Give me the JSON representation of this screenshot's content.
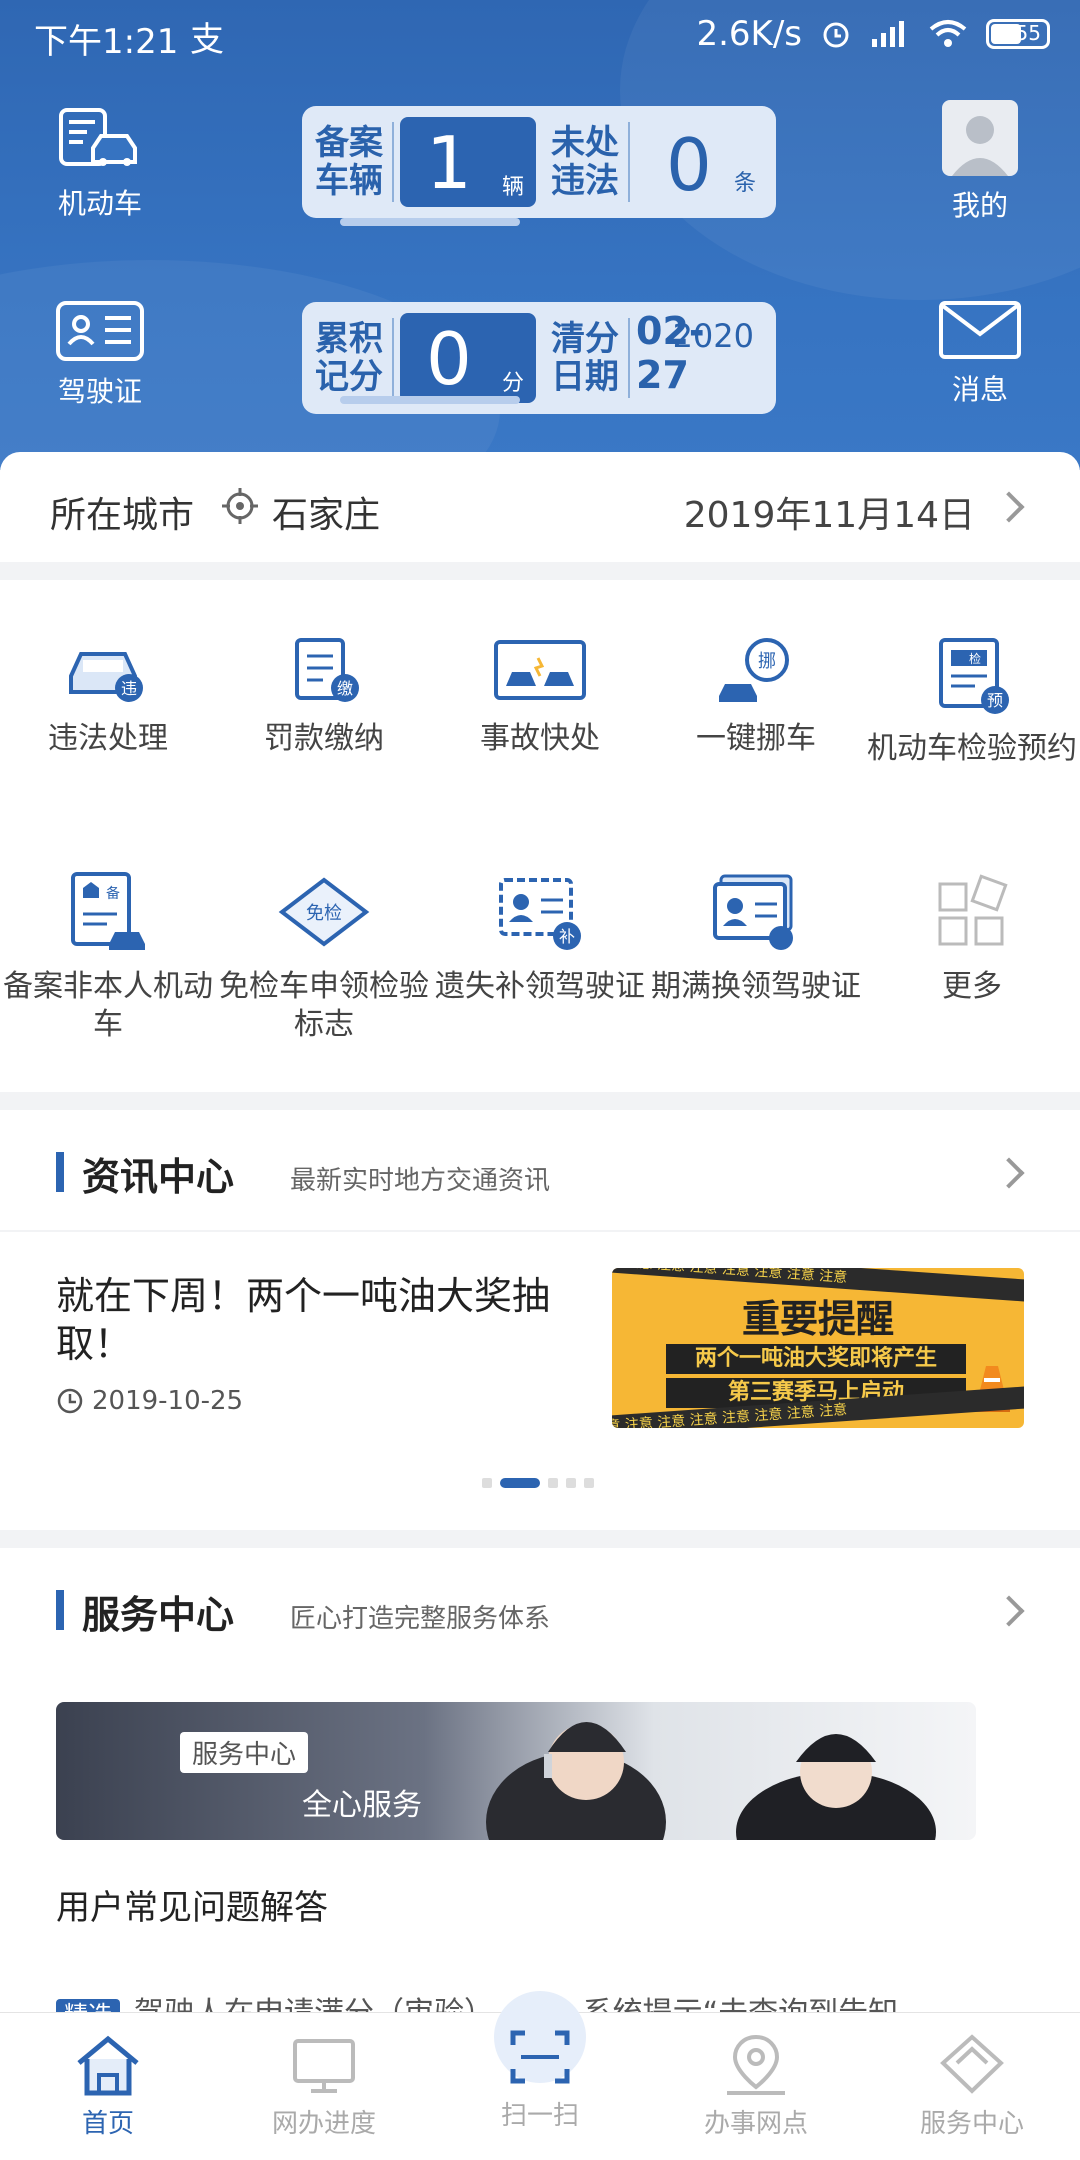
{
  "status_bar": {
    "time": "下午1:21",
    "pay_icon": "支",
    "net_speed": "2.6K/s",
    "battery": "55"
  },
  "header": {
    "left_top": {
      "label": "机动车",
      "icon": "car-document-icon"
    },
    "left_bottom": {
      "label": "驾驶证",
      "icon": "license-icon"
    },
    "right_top": {
      "label": "我的",
      "icon": "avatar-icon"
    },
    "right_bottom": {
      "label": "消息",
      "icon": "envelope-icon"
    },
    "vehicles": {
      "label_line1": "备案",
      "label_line2": "车辆",
      "value": "1",
      "unit": "辆"
    },
    "violations": {
      "label_line1": "未处",
      "label_line2": "违法",
      "value": "0",
      "unit": "条"
    },
    "points": {
      "label_line1": "累积",
      "label_line2": "记分",
      "value": "0",
      "unit": "分"
    },
    "clear_date": {
      "label_line1": "清分",
      "label_line2": "日期",
      "year": "2020",
      "month_day": "02-27"
    }
  },
  "city_bar": {
    "label": "所在城市",
    "city": "石家庄",
    "date": "2019年11月14日"
  },
  "services": [
    {
      "label": "违法处理",
      "icon": "violation-car-icon"
    },
    {
      "label": "罚款缴纳",
      "icon": "fine-payment-icon"
    },
    {
      "label": "事故快处",
      "icon": "accident-icon"
    },
    {
      "label": "一键挪车",
      "icon": "move-car-icon"
    },
    {
      "label": "机动车检验预约",
      "icon": "inspection-appointment-icon"
    },
    {
      "label": "备案非本人机动车",
      "icon": "register-vehicle-icon"
    },
    {
      "label": "免检车申领检验标志",
      "icon": "exempt-label-icon"
    },
    {
      "label": "遗失补领驾驶证",
      "icon": "reissue-license-icon"
    },
    {
      "label": "期满换领驾驶证",
      "icon": "renew-license-icon"
    },
    {
      "label": "更多",
      "icon": "more-grid-icon"
    }
  ],
  "news": {
    "title": "资讯中心",
    "subtitle": "最新实时地方交通资讯",
    "item_title": "就在下周！两个一吨油大奖抽取！",
    "item_date": "2019-10-25",
    "image_headline": "重要提醒",
    "image_line1": "两个一吨油大奖即将产生",
    "image_line2": "第三赛季马上启动",
    "image_tape": "注意 注意 注意 注意 注意 注意 注意 注意"
  },
  "service_center": {
    "title": "服务中心",
    "subtitle": "匠心打造完整服务体系",
    "banner_tag": "服务中心",
    "banner_slogan": "全心服务",
    "faq_title": "用户常见问题解答",
    "faq_chip": "精选",
    "faq_text": "驾驶人在申请满分（审验）...时，系统提示“未查询到告知"
  },
  "bottom_nav": [
    {
      "label": "首页",
      "icon": "home-icon",
      "active": true
    },
    {
      "label": "网办进度",
      "icon": "monitor-icon",
      "active": false
    },
    {
      "label": "扫一扫",
      "icon": "scan-icon",
      "active": false
    },
    {
      "label": "办事网点",
      "icon": "location-pin-icon",
      "active": false
    },
    {
      "label": "服务中心",
      "icon": "service-diamond-icon",
      "active": false
    }
  ],
  "colors": {
    "primary": "#2c64b1",
    "header": "#3673c1",
    "highlight": "#f6b735"
  }
}
